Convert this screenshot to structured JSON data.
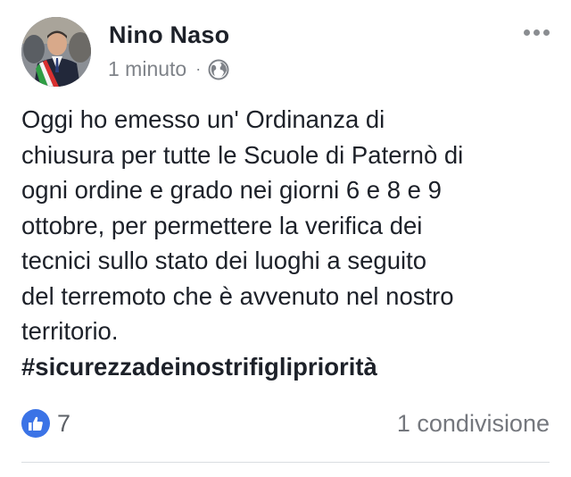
{
  "post": {
    "author": "Nino Naso",
    "timestamp": "1 minuto",
    "separator": "·",
    "privacy_icon": "globe-icon",
    "more_icon": "more-options-icon",
    "body_lines": [
      "Oggi ho emesso un' Ordinanza di",
      "chiusura per tutte le Scuole di Paternò di",
      "ogni ordine e grado nei giorni 6 e 8 e 9",
      "ottobre, per permettere la verifica dei",
      "tecnici sullo stato dei luoghi a seguito",
      "del terremoto che è avvenuto nel nostro",
      "territorio."
    ],
    "hashtag": "#sicurezzadeinostrifiglipriorità"
  },
  "footer": {
    "reaction_icon": "like-icon",
    "reaction_count": "7",
    "shares": "1 condivisione"
  },
  "colors": {
    "like_blue": "#3b73e6",
    "meta_gray": "#7f8389",
    "text": "#1d2129"
  }
}
